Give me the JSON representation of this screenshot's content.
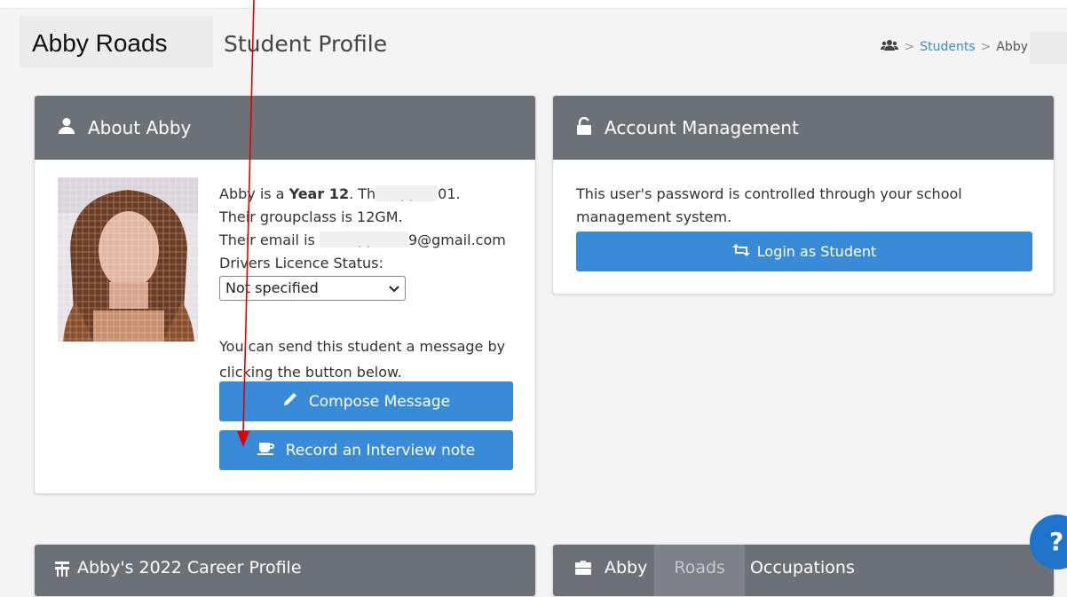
{
  "header": {
    "student_name": "Abby Roads",
    "page_title": "Student Profile"
  },
  "breadcrumb": {
    "icon": "users-icon",
    "separator": ">",
    "students_link": "Students",
    "current": "Abby"
  },
  "about": {
    "title": "About Abby",
    "intro_prefix": "Abby is a",
    "year_level": "Year 12",
    "intro_rest": ". Th",
    "intro_redacted": ". .",
    "intro_tail": "01.",
    "groupclass_line": "Their groupclass is 12GM.",
    "email_prefix": "Their email is",
    "email_redacted": ". .",
    "email_tail": "9@gmail.com",
    "licence_label": "Drivers Licence Status:",
    "licence_value": "Not specified",
    "message_line1": "You can send this student a message by",
    "message_line2": "clicking the button below.",
    "compose_button": "Compose Message",
    "interview_button": "Record an Interview note"
  },
  "account": {
    "title": "Account Management",
    "text_line1": "This user's password is controlled through your school",
    "text_line2": "management system.",
    "login_button": "Login as Student"
  },
  "career": {
    "title": "Abby's 2022 Career Profile"
  },
  "occupations": {
    "first_name": "Abby",
    "last_name": "Roads",
    "title_rest": "Occupations"
  },
  "help": {
    "label": "?"
  },
  "colors": {
    "header_bar": "#6c7178",
    "button": "#3a8bd7",
    "link": "#3c8dbc",
    "annotation": "#e00000"
  }
}
